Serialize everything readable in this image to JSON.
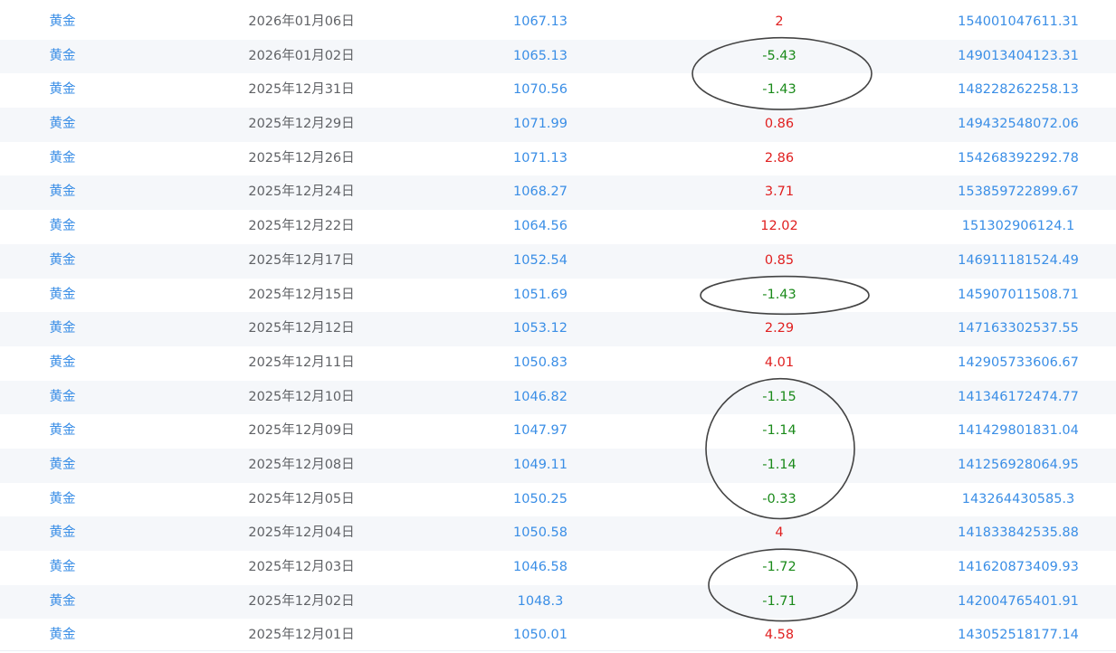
{
  "table": {
    "rows": [
      {
        "name": "黄金",
        "date": "2026年01月06日",
        "price": "1067.13",
        "change": "2",
        "direction": "up",
        "amount": "154001047611.31"
      },
      {
        "name": "黄金",
        "date": "2026年01月02日",
        "price": "1065.13",
        "change": "-5.43",
        "direction": "down",
        "amount": "149013404123.31"
      },
      {
        "name": "黄金",
        "date": "2025年12月31日",
        "price": "1070.56",
        "change": "-1.43",
        "direction": "down",
        "amount": "148228262258.13"
      },
      {
        "name": "黄金",
        "date": "2025年12月29日",
        "price": "1071.99",
        "change": "0.86",
        "direction": "up",
        "amount": "149432548072.06"
      },
      {
        "name": "黄金",
        "date": "2025年12月26日",
        "price": "1071.13",
        "change": "2.86",
        "direction": "up",
        "amount": "154268392292.78"
      },
      {
        "name": "黄金",
        "date": "2025年12月24日",
        "price": "1068.27",
        "change": "3.71",
        "direction": "up",
        "amount": "153859722899.67"
      },
      {
        "name": "黄金",
        "date": "2025年12月22日",
        "price": "1064.56",
        "change": "12.02",
        "direction": "up",
        "amount": "151302906124.1"
      },
      {
        "name": "黄金",
        "date": "2025年12月17日",
        "price": "1052.54",
        "change": "0.85",
        "direction": "up",
        "amount": "146911181524.49"
      },
      {
        "name": "黄金",
        "date": "2025年12月15日",
        "price": "1051.69",
        "change": "-1.43",
        "direction": "down",
        "amount": "145907011508.71"
      },
      {
        "name": "黄金",
        "date": "2025年12月12日",
        "price": "1053.12",
        "change": "2.29",
        "direction": "up",
        "amount": "147163302537.55"
      },
      {
        "name": "黄金",
        "date": "2025年12月11日",
        "price": "1050.83",
        "change": "4.01",
        "direction": "up",
        "amount": "142905733606.67"
      },
      {
        "name": "黄金",
        "date": "2025年12月10日",
        "price": "1046.82",
        "change": "-1.15",
        "direction": "down",
        "amount": "141346172474.77"
      },
      {
        "name": "黄金",
        "date": "2025年12月09日",
        "price": "1047.97",
        "change": "-1.14",
        "direction": "down",
        "amount": "141429801831.04"
      },
      {
        "name": "黄金",
        "date": "2025年12月08日",
        "price": "1049.11",
        "change": "-1.14",
        "direction": "down",
        "amount": "141256928064.95"
      },
      {
        "name": "黄金",
        "date": "2025年12月05日",
        "price": "1050.25",
        "change": "-0.33",
        "direction": "down",
        "amount": "143264430585.3"
      },
      {
        "name": "黄金",
        "date": "2025年12月04日",
        "price": "1050.58",
        "change": "4",
        "direction": "up",
        "amount": "141833842535.88"
      },
      {
        "name": "黄金",
        "date": "2025年12月03日",
        "price": "1046.58",
        "change": "-1.72",
        "direction": "down",
        "amount": "141620873409.93"
      },
      {
        "name": "黄金",
        "date": "2025年12月02日",
        "price": "1048.3",
        "change": "-1.71",
        "direction": "down",
        "amount": "142004765401.91"
      },
      {
        "name": "黄金",
        "date": "2025年12月01日",
        "price": "1050.01",
        "change": "4.58",
        "direction": "up",
        "amount": "143052518177.14"
      }
    ]
  },
  "annotations": {
    "circled_rows": [
      [
        1,
        2
      ],
      [
        8,
        8
      ],
      [
        11,
        14
      ],
      [
        16,
        17
      ]
    ]
  },
  "colors": {
    "link": "#3a8ee6",
    "up": "#e02020",
    "down": "#1a8a1a",
    "stripe": "#f5f7fa",
    "annotation": "#444444"
  }
}
